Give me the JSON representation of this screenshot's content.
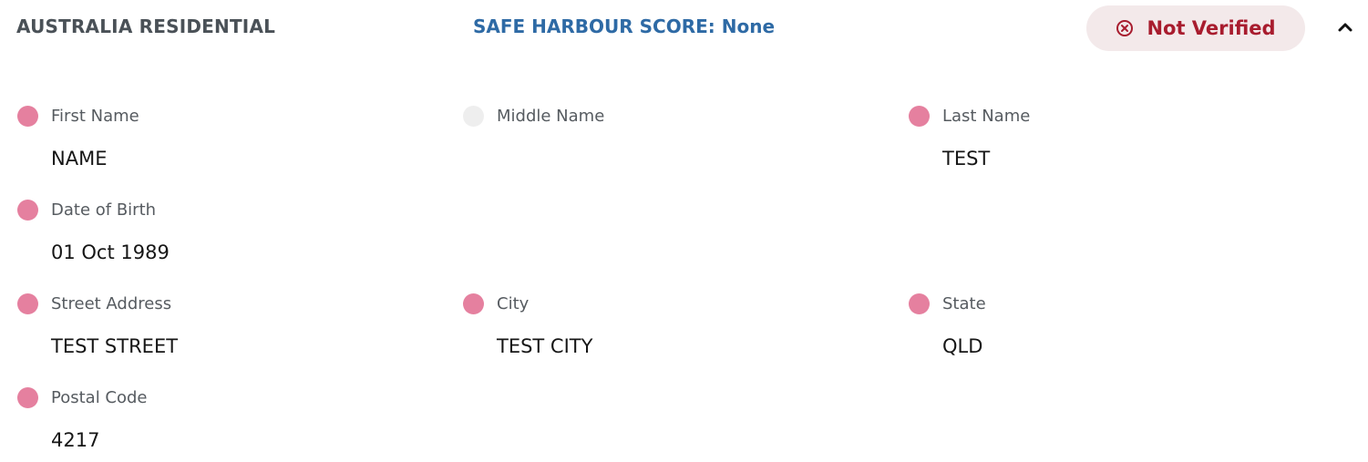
{
  "header": {
    "title": "AUSTRALIA RESIDENTIAL",
    "score_label": "SAFE HARBOUR SCORE: None",
    "status": "Not Verified",
    "status_icon": "x-circle-icon",
    "collapse_icon": "chevron-up-icon"
  },
  "colors": {
    "matched_dot": "#e5809f",
    "empty_dot": "#eeeeee",
    "score_text": "#2e6aa5",
    "status_text": "#a81c2e",
    "status_bg": "#f3e9ea"
  },
  "fields": {
    "first_name": {
      "label": "First Name",
      "value": "NAME",
      "state": "matched"
    },
    "middle_name": {
      "label": "Middle Name",
      "value": "",
      "state": "empty"
    },
    "last_name": {
      "label": "Last Name",
      "value": "TEST",
      "state": "matched"
    },
    "date_of_birth": {
      "label": "Date of Birth",
      "value": "01 Oct 1989",
      "state": "matched"
    },
    "street_address": {
      "label": "Street Address",
      "value": "TEST STREET",
      "state": "matched"
    },
    "city": {
      "label": "City",
      "value": "TEST CITY",
      "state": "matched"
    },
    "state": {
      "label": "State",
      "value": "QLD",
      "state": "matched"
    },
    "postal_code": {
      "label": "Postal Code",
      "value": "4217",
      "state": "matched"
    }
  }
}
